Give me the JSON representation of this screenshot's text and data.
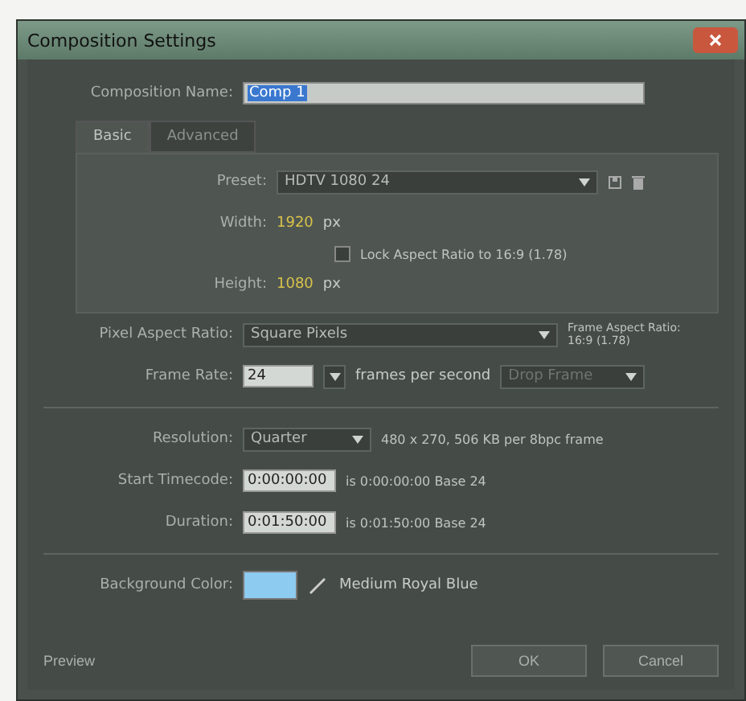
{
  "window": {
    "title": "Composition Settings"
  },
  "composition_name": {
    "label": "Composition Name:",
    "value": "Comp 1"
  },
  "tabs": [
    {
      "label": "Basic",
      "selected": true
    },
    {
      "label": "Advanced",
      "selected": false
    }
  ],
  "preset": {
    "label": "Preset:",
    "value": "HDTV 1080 24"
  },
  "width": {
    "label": "Width:",
    "value": "1920",
    "unit": "px"
  },
  "lock_aspect": {
    "label": "Lock Aspect Ratio to 16:9 (1.78)",
    "checked": false
  },
  "height": {
    "label": "Height:",
    "value": "1080",
    "unit": "px"
  },
  "pixel_aspect": {
    "label": "Pixel Aspect Ratio:",
    "value": "Square Pixels",
    "note_title": "Frame Aspect Ratio:",
    "note_value": "16:9 (1.78)"
  },
  "frame_rate": {
    "label": "Frame Rate:",
    "value": "24",
    "unit": "frames per second",
    "drop_frame": {
      "value": "Drop Frame",
      "disabled": true
    }
  },
  "resolution": {
    "label": "Resolution:",
    "value": "Quarter",
    "info": "480 x 270, 506 KB per 8bpc frame"
  },
  "start_timecode": {
    "label": "Start Timecode:",
    "value": "0:00:00:00",
    "info": "is 0:00:00:00  Base 24"
  },
  "duration": {
    "label": "Duration:",
    "value": "0:01:50:00",
    "info": "is 0:01:50:00  Base 24"
  },
  "background_color": {
    "label": "Background Color:",
    "color": "#8ecbf0",
    "name": "Medium Royal Blue"
  },
  "buttons": [
    {
      "label": "Preview",
      "kind": "left"
    },
    {
      "label": "OK",
      "kind": "right"
    },
    {
      "label": "Cancel",
      "kind": "right"
    }
  ]
}
